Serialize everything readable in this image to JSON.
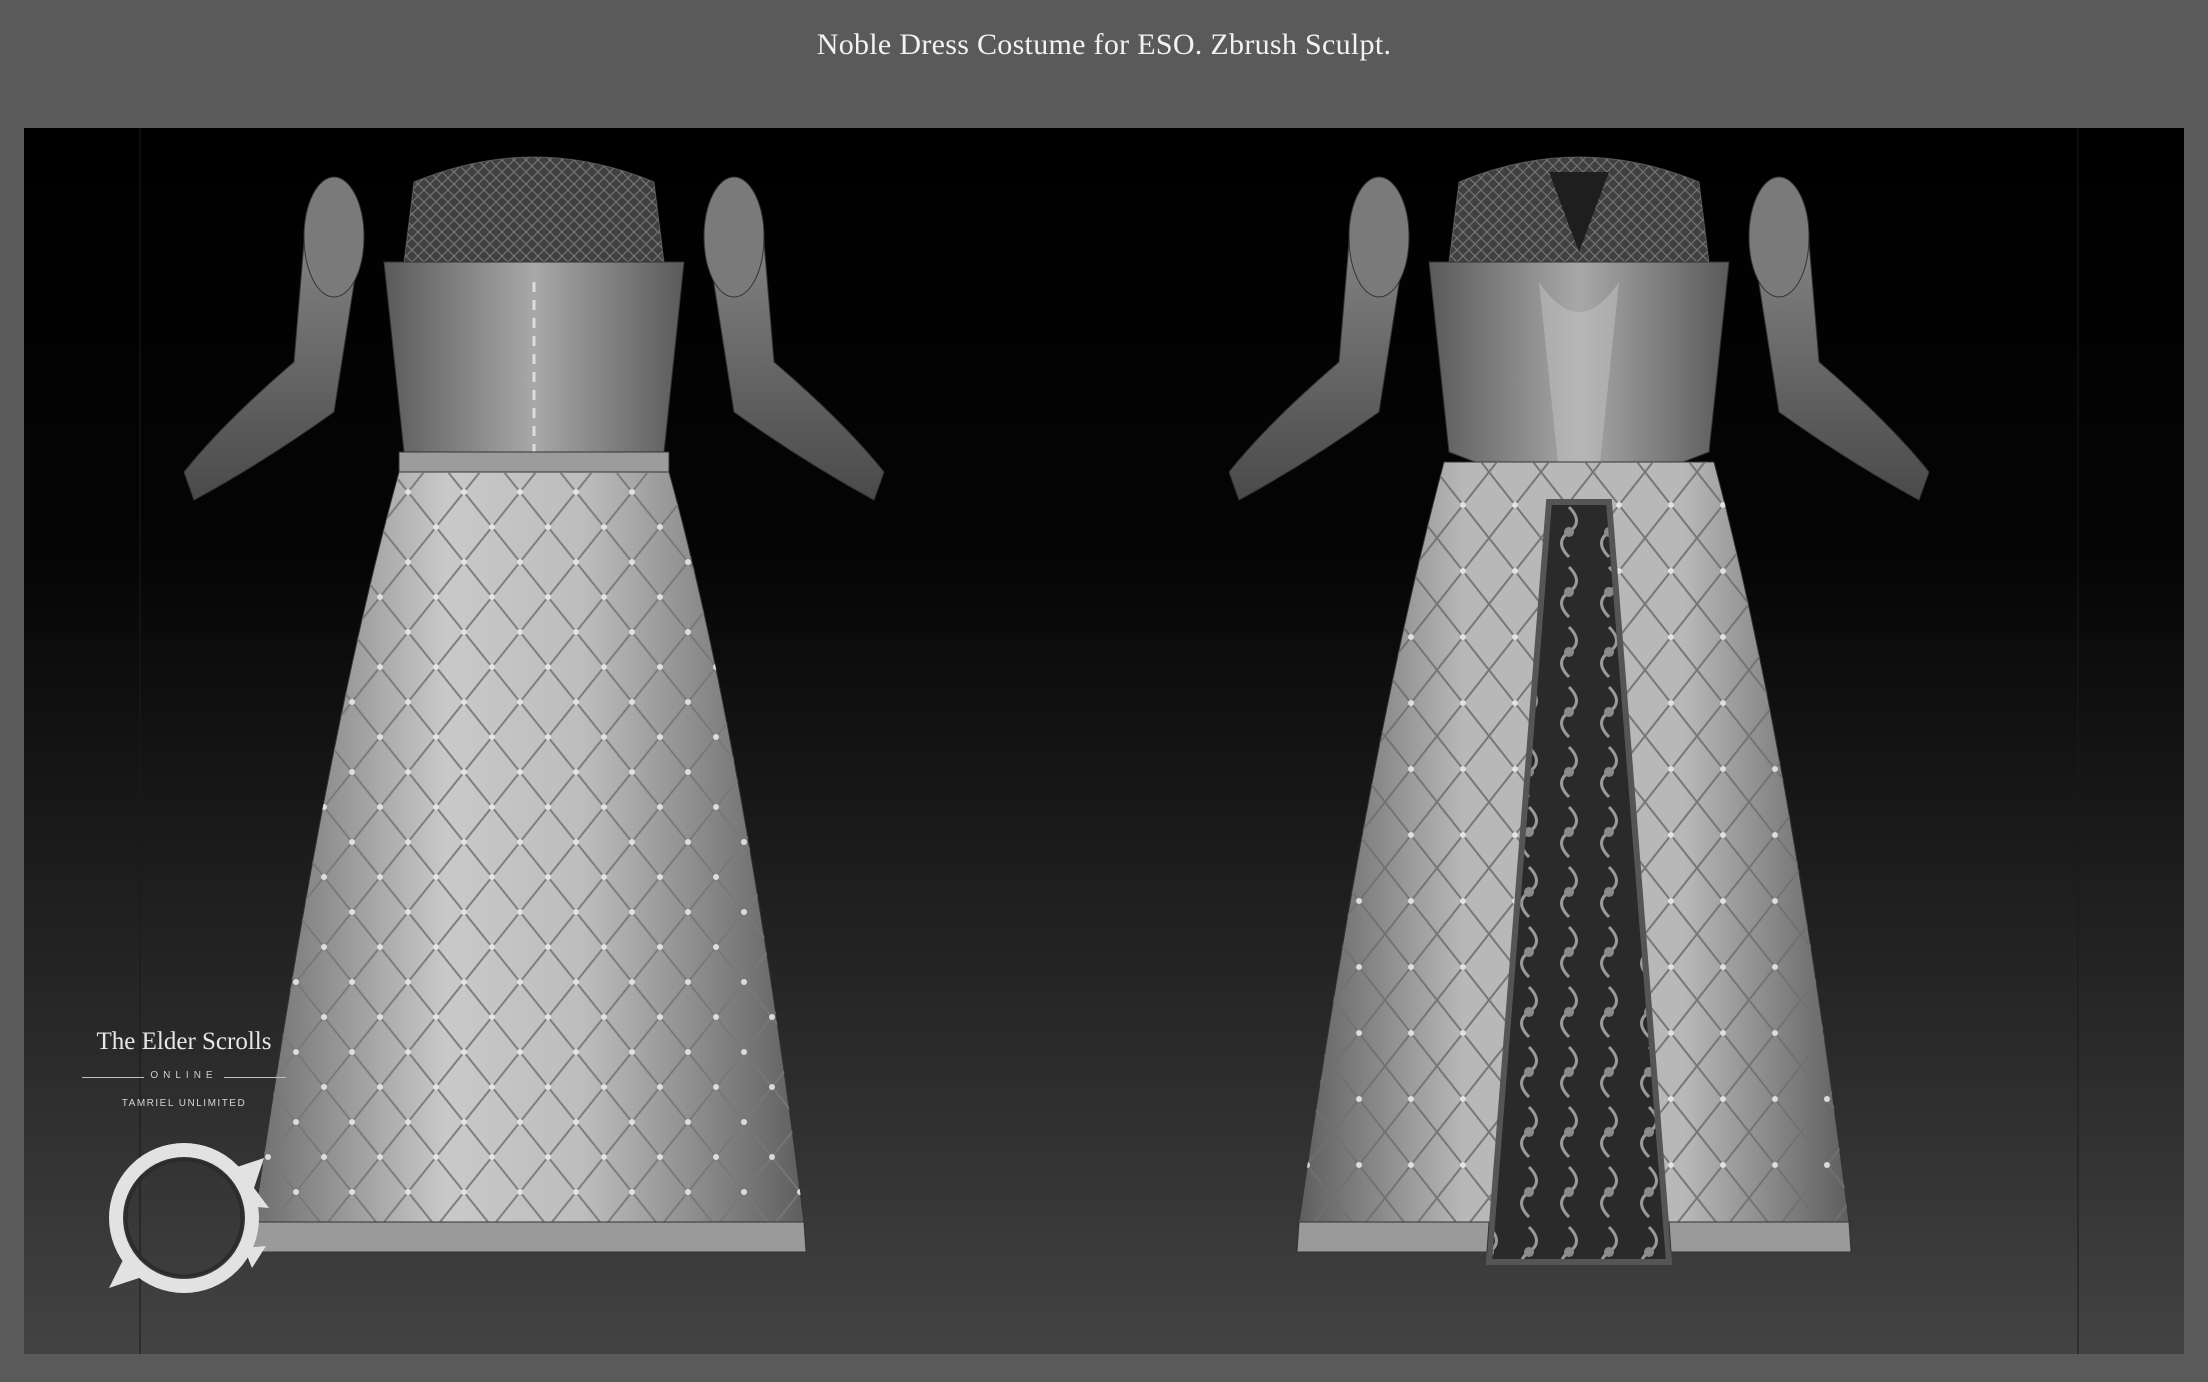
{
  "header": {
    "title": "Noble Dress Costume for ESO. Zbrush Sculpt."
  },
  "logo": {
    "title": "The Elder Scrolls",
    "online": "ONLINE",
    "subtitle": "TAMRIEL UNLIMITED"
  },
  "render": {
    "views": [
      "back-view",
      "front-view"
    ]
  }
}
